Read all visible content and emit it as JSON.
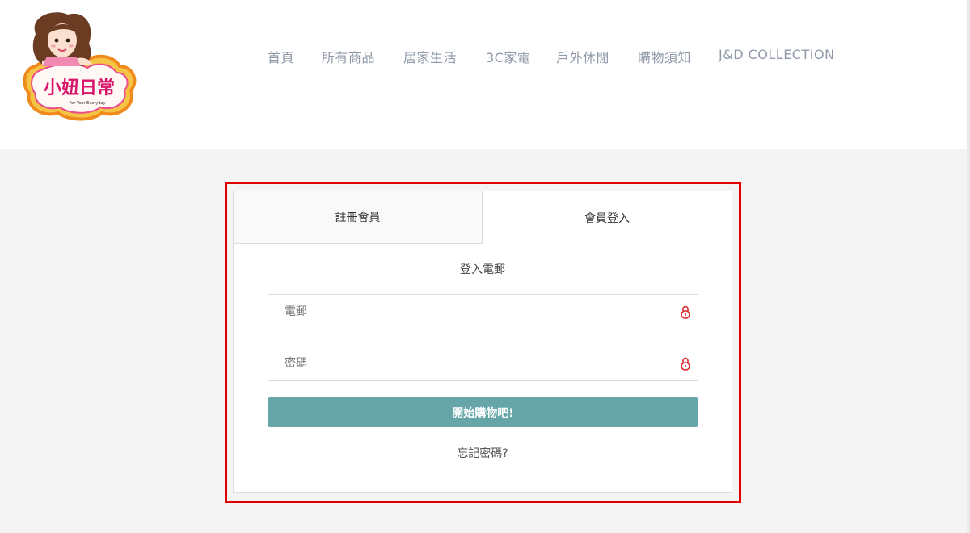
{
  "logo": {
    "brand_text": "小妞日常",
    "tagline": "For Your Everyday",
    "icon": "girl-mascot-logo"
  },
  "nav": {
    "items": [
      {
        "label": "首頁"
      },
      {
        "label": "所有商品"
      },
      {
        "label": "居家生活"
      },
      {
        "label": "3C家電"
      },
      {
        "label": "戶外休閒"
      },
      {
        "label": "購物須知"
      },
      {
        "label": "J&D COLLECTION"
      }
    ]
  },
  "auth": {
    "tabs": [
      {
        "label": "註冊會員",
        "active": false
      },
      {
        "label": "會員登入",
        "active": true
      }
    ],
    "form_title": "登入電郵",
    "email": {
      "placeholder": "電郵",
      "value": "",
      "icon": "lock-icon"
    },
    "password": {
      "placeholder": "密碼",
      "value": "",
      "icon": "lock-icon"
    },
    "submit_label": "開始購物吧!",
    "forgot_label": "忘記密碼?"
  },
  "colors": {
    "accent": "#66a6a9",
    "highlight_border": "#e00000",
    "nav_text": "#9099a8",
    "lock_icon": "#e0262b",
    "page_bg": "#f4f4f4"
  }
}
